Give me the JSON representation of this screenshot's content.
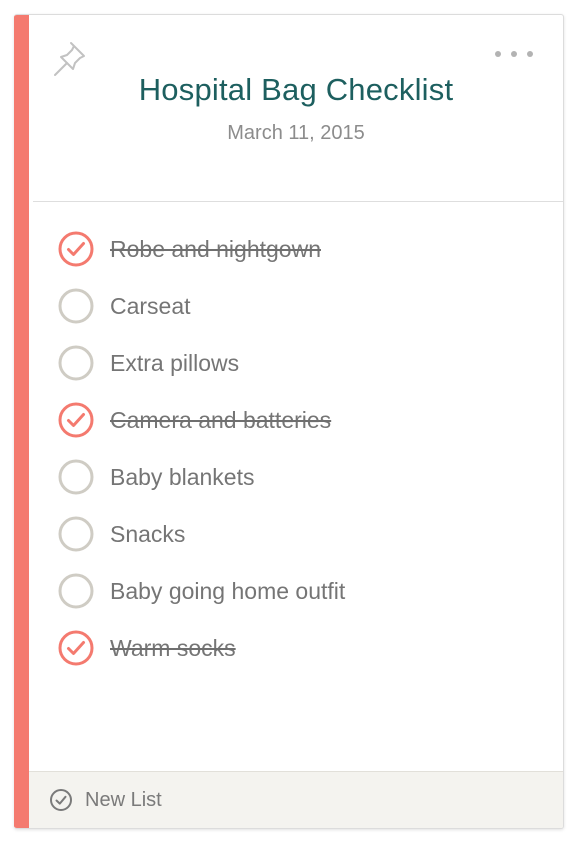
{
  "note": {
    "title": "Hospital Bag Checklist",
    "date": "March 11, 2015",
    "accent_color": "#f47a6f",
    "title_color": "#1d5f5f",
    "pin_icon": "pin-icon",
    "menu_icon": "more-options-icon"
  },
  "items": [
    {
      "label": "Robe and nightgown",
      "checked": true
    },
    {
      "label": "Carseat",
      "checked": false
    },
    {
      "label": "Extra pillows",
      "checked": false
    },
    {
      "label": "Camera and batteries",
      "checked": true
    },
    {
      "label": "Baby blankets",
      "checked": false
    },
    {
      "label": "Snacks",
      "checked": false
    },
    {
      "label": "Baby going home outfit",
      "checked": false
    },
    {
      "label": "Warm socks",
      "checked": true
    }
  ],
  "footer": {
    "new_list_label": "New List",
    "new_list_icon": "check-circle-icon"
  }
}
